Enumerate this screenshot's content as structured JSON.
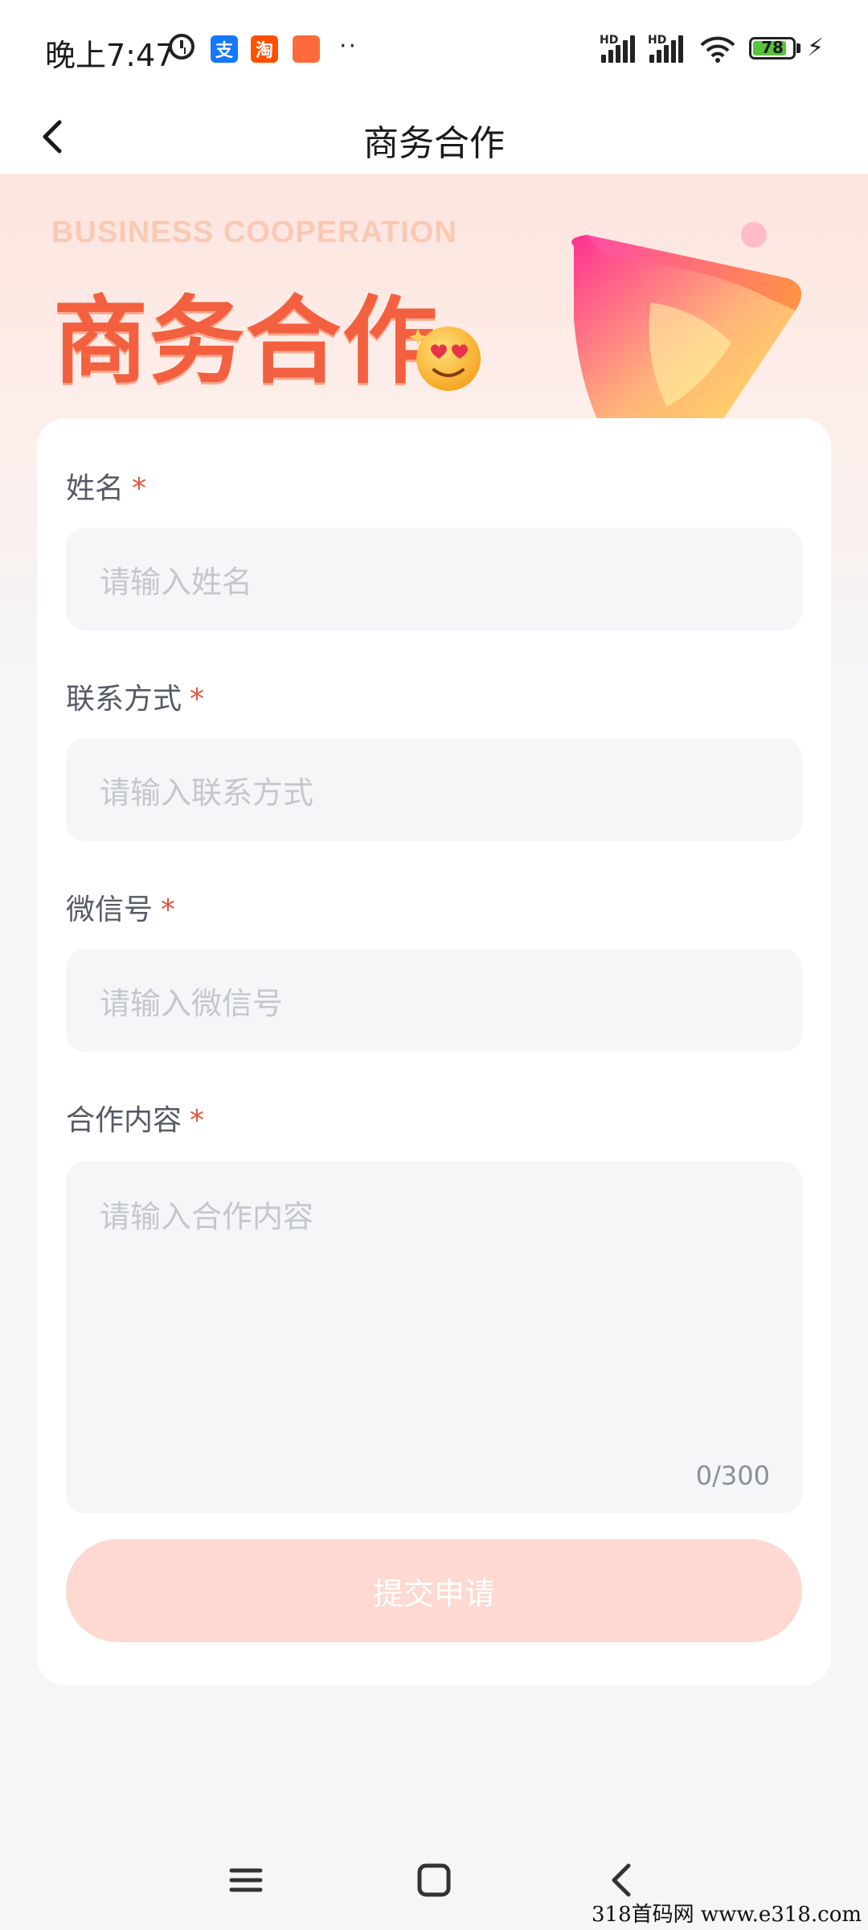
{
  "status_bar": {
    "time": "晚上7:47",
    "hd_label_1": "HD",
    "hd_label_2": "HD",
    "battery": "78",
    "app_icons": [
      "alipay-icon",
      "taobao-icon",
      "shopping-bag-icon"
    ],
    "more_dots": "··",
    "colors": {
      "alipay": "#1677ff",
      "taobao": "#ff5000",
      "shop": "#ff6a3d",
      "battery_fill": "#5ac43a"
    }
  },
  "nav": {
    "title": "商务合作"
  },
  "banner": {
    "subtitle_en": "BUSINESS COOPERATION",
    "title_cn": "商务合作"
  },
  "form": {
    "fields": [
      {
        "label": "姓名",
        "required_mark": "*",
        "placeholder": "请输入姓名"
      },
      {
        "label": "联系方式",
        "required_mark": "*",
        "placeholder": "请输入联系方式"
      },
      {
        "label": "微信号",
        "required_mark": "*",
        "placeholder": "请输入微信号"
      },
      {
        "label": "合作内容",
        "required_mark": "*",
        "placeholder": "请输入合作内容",
        "counter": "0/300"
      }
    ],
    "submit_label": "提交申请"
  },
  "watermark": "318首码网 www.e318.com",
  "colors": {
    "accent": "#f2603f",
    "submit_bg": "#fdd9d1",
    "required": "#e5533d",
    "page_bg": "#f5f6f8"
  }
}
